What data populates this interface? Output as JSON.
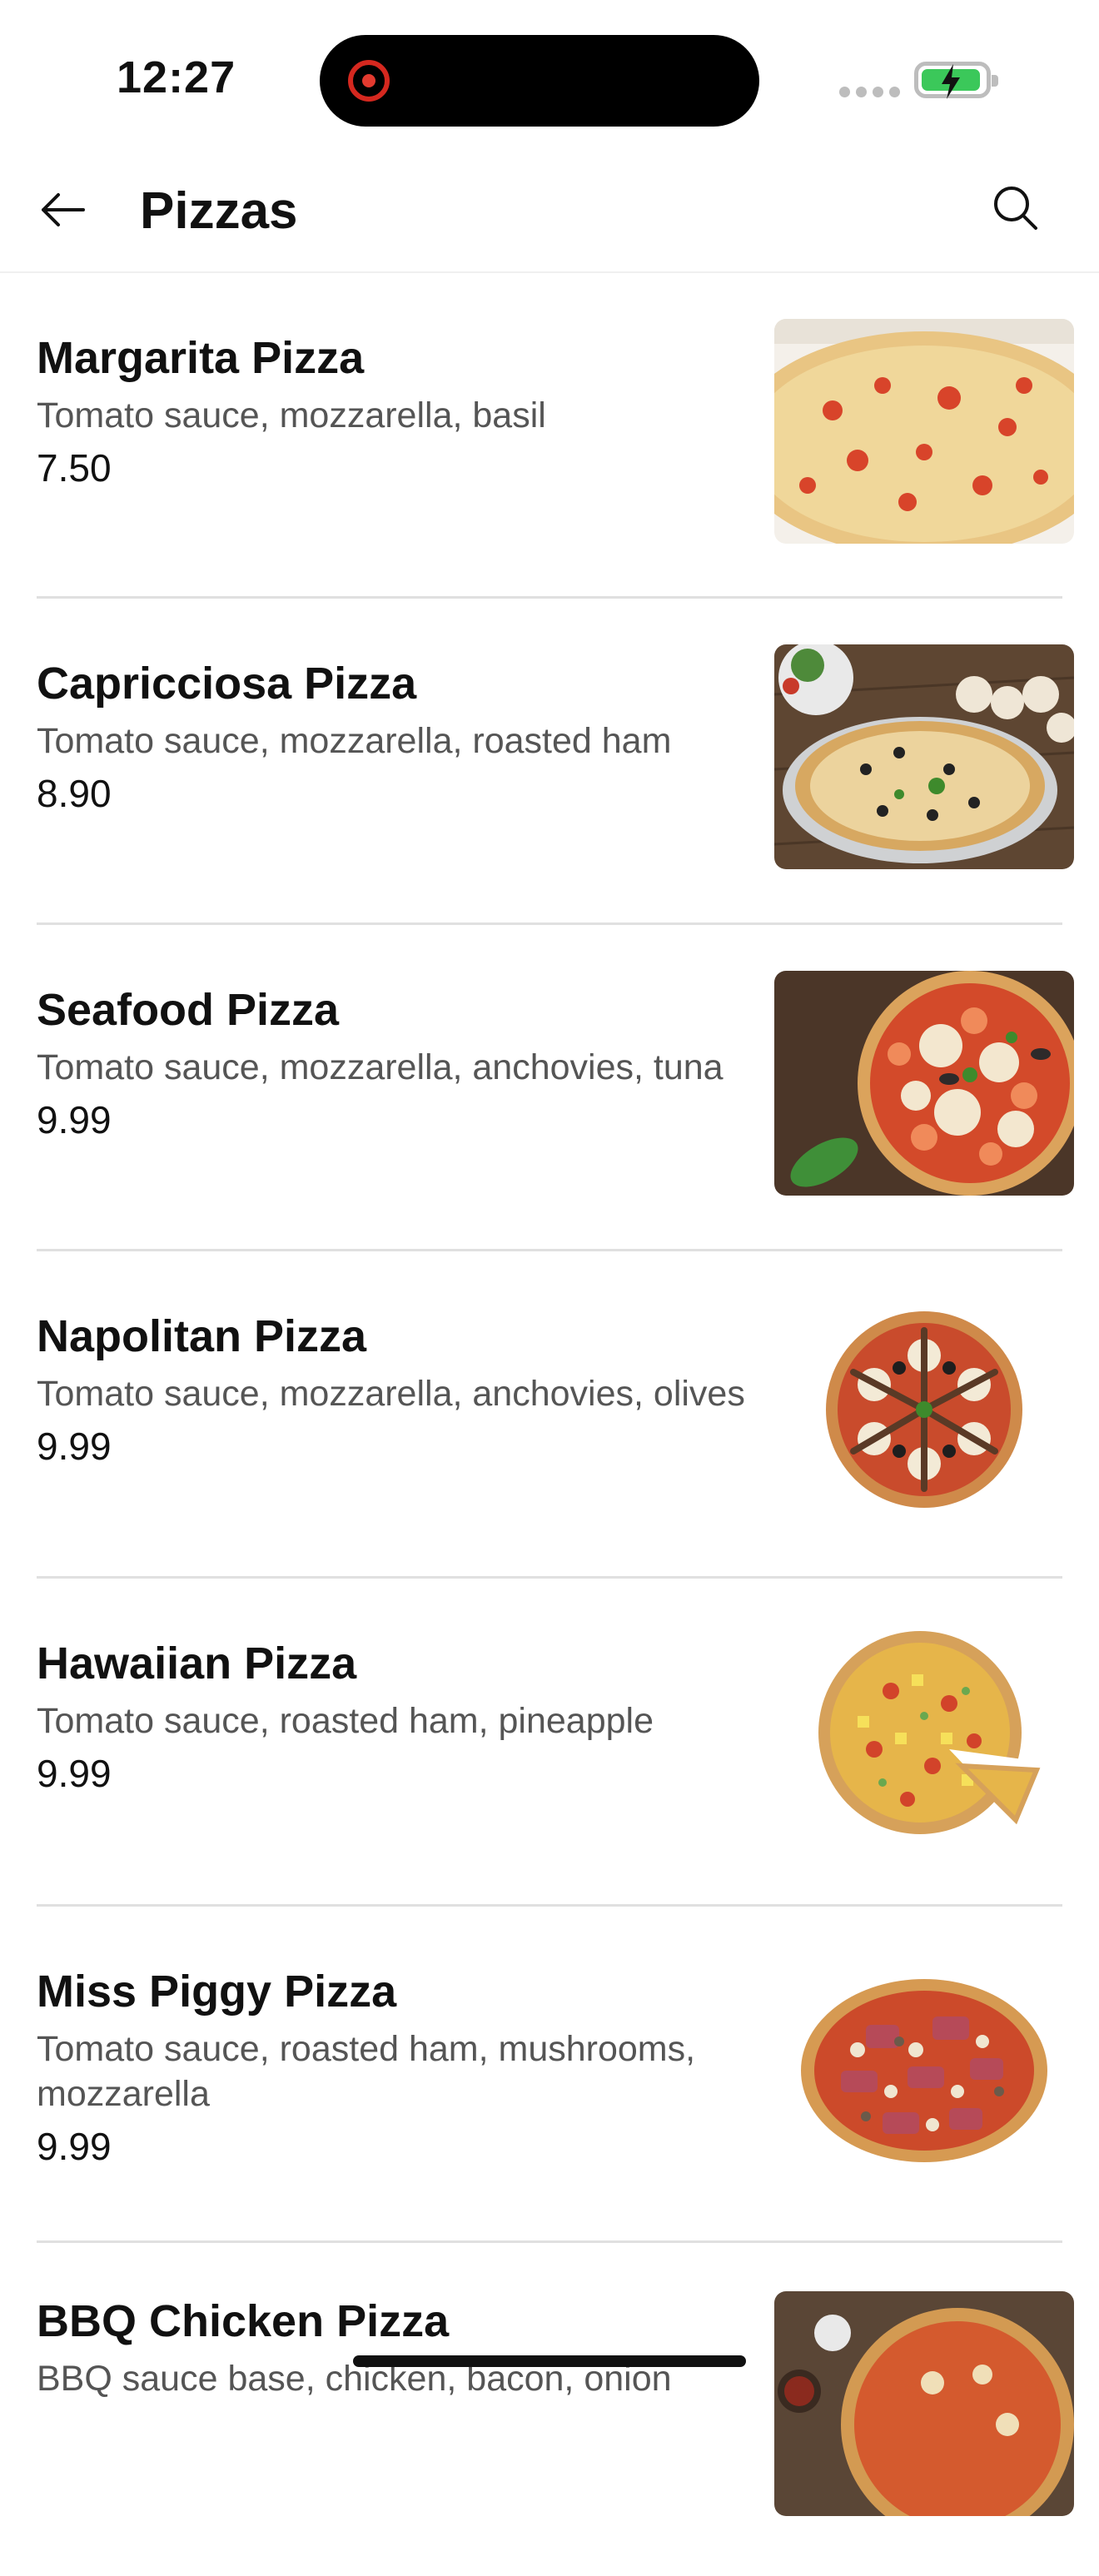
{
  "status_bar": {
    "time": "12:27"
  },
  "header": {
    "title": "Pizzas"
  },
  "pizzas": [
    {
      "name": "Margarita Pizza",
      "description": "Tomato sauce, mozzarella, basil",
      "price": "7.50"
    },
    {
      "name": "Capricciosa Pizza",
      "description": "Tomato sauce, mozzarella, roasted ham",
      "price": "8.90"
    },
    {
      "name": "Seafood Pizza",
      "description": "Tomato sauce, mozzarella, anchovies, tuna",
      "price": "9.99"
    },
    {
      "name": "Napolitan Pizza",
      "description": "Tomato sauce, mozzarella, anchovies, olives",
      "price": "9.99"
    },
    {
      "name": "Hawaiian Pizza",
      "description": "Tomato sauce, roasted ham, pineapple",
      "price": "9.99"
    },
    {
      "name": "Miss Piggy Pizza",
      "description": "Tomato sauce, roasted ham, mushrooms, mozzarella",
      "price": "9.99"
    },
    {
      "name": "BBQ Chicken Pizza",
      "description": "BBQ sauce base, chicken, bacon, onion",
      "price": ""
    }
  ],
  "icons": {
    "back": "arrow-left-icon",
    "search": "search-icon",
    "record": "record-icon",
    "battery": "battery-charging-icon"
  },
  "colors": {
    "accent_record": "#d5281f",
    "battery_fill": "#3bc85a",
    "divider": "#e0e0e0"
  }
}
